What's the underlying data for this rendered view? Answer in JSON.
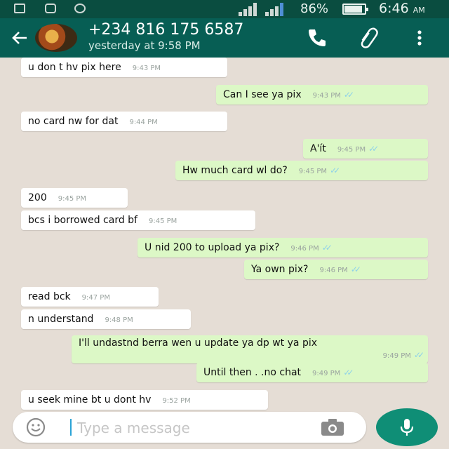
{
  "status_bar": {
    "battery": "86%",
    "time": "6:46",
    "ampm": "AM"
  },
  "header": {
    "contact": "+234 816 175 6587",
    "last_seen": "yesterday at 9:58 PM"
  },
  "messages": [
    {
      "text": "u don t hv pix here",
      "time": "9:43 PM",
      "dir": "in"
    },
    {
      "text": "Can I see ya pix",
      "time": "9:43 PM",
      "dir": "out"
    },
    {
      "text": "no card nw for dat",
      "time": "9:44 PM",
      "dir": "in"
    },
    {
      "text": "A'ít",
      "time": "9:45 PM",
      "dir": "out"
    },
    {
      "text": "Hw much card wl do?",
      "time": "9:45 PM",
      "dir": "out"
    },
    {
      "text": "200",
      "time": "9:45 PM",
      "dir": "in"
    },
    {
      "text": "bcs i borrowed card bf",
      "time": "9:45 PM",
      "dir": "in"
    },
    {
      "text": "U nid 200 to upload ya pix?",
      "time": "9:46 PM",
      "dir": "out"
    },
    {
      "text": "Ya own pix?",
      "time": "9:46 PM",
      "dir": "out"
    },
    {
      "text": "read bck",
      "time": "9:47 PM",
      "dir": "in"
    },
    {
      "text": "n understand",
      "time": "9:48 PM",
      "dir": "in"
    },
    {
      "text": "I'll undastnd berra wen u update ya dp wt ya pix",
      "time": "9:49 PM",
      "dir": "out"
    },
    {
      "text": "Until then . .no chat",
      "time": "9:49 PM",
      "dir": "out"
    },
    {
      "text": "u seek mine bt u dont hv",
      "time": "9:52 PM",
      "dir": "in"
    }
  ],
  "input": {
    "placeholder": "Type a message"
  },
  "colors": {
    "header": "#075e54",
    "status_bar": "#0a4d40",
    "outgoing_bubble": "#dcf8c6",
    "incoming_bubble": "#ffffff",
    "background": "#e5ddd5",
    "mic_button": "#0f8e76",
    "read_ticks": "#8fd2e8"
  },
  "icons": [
    "back-arrow-icon",
    "phone-icon",
    "attachment-icon",
    "more-vert-icon",
    "emoji-icon",
    "camera-icon",
    "mic-icon",
    "read-ticks-icon"
  ]
}
